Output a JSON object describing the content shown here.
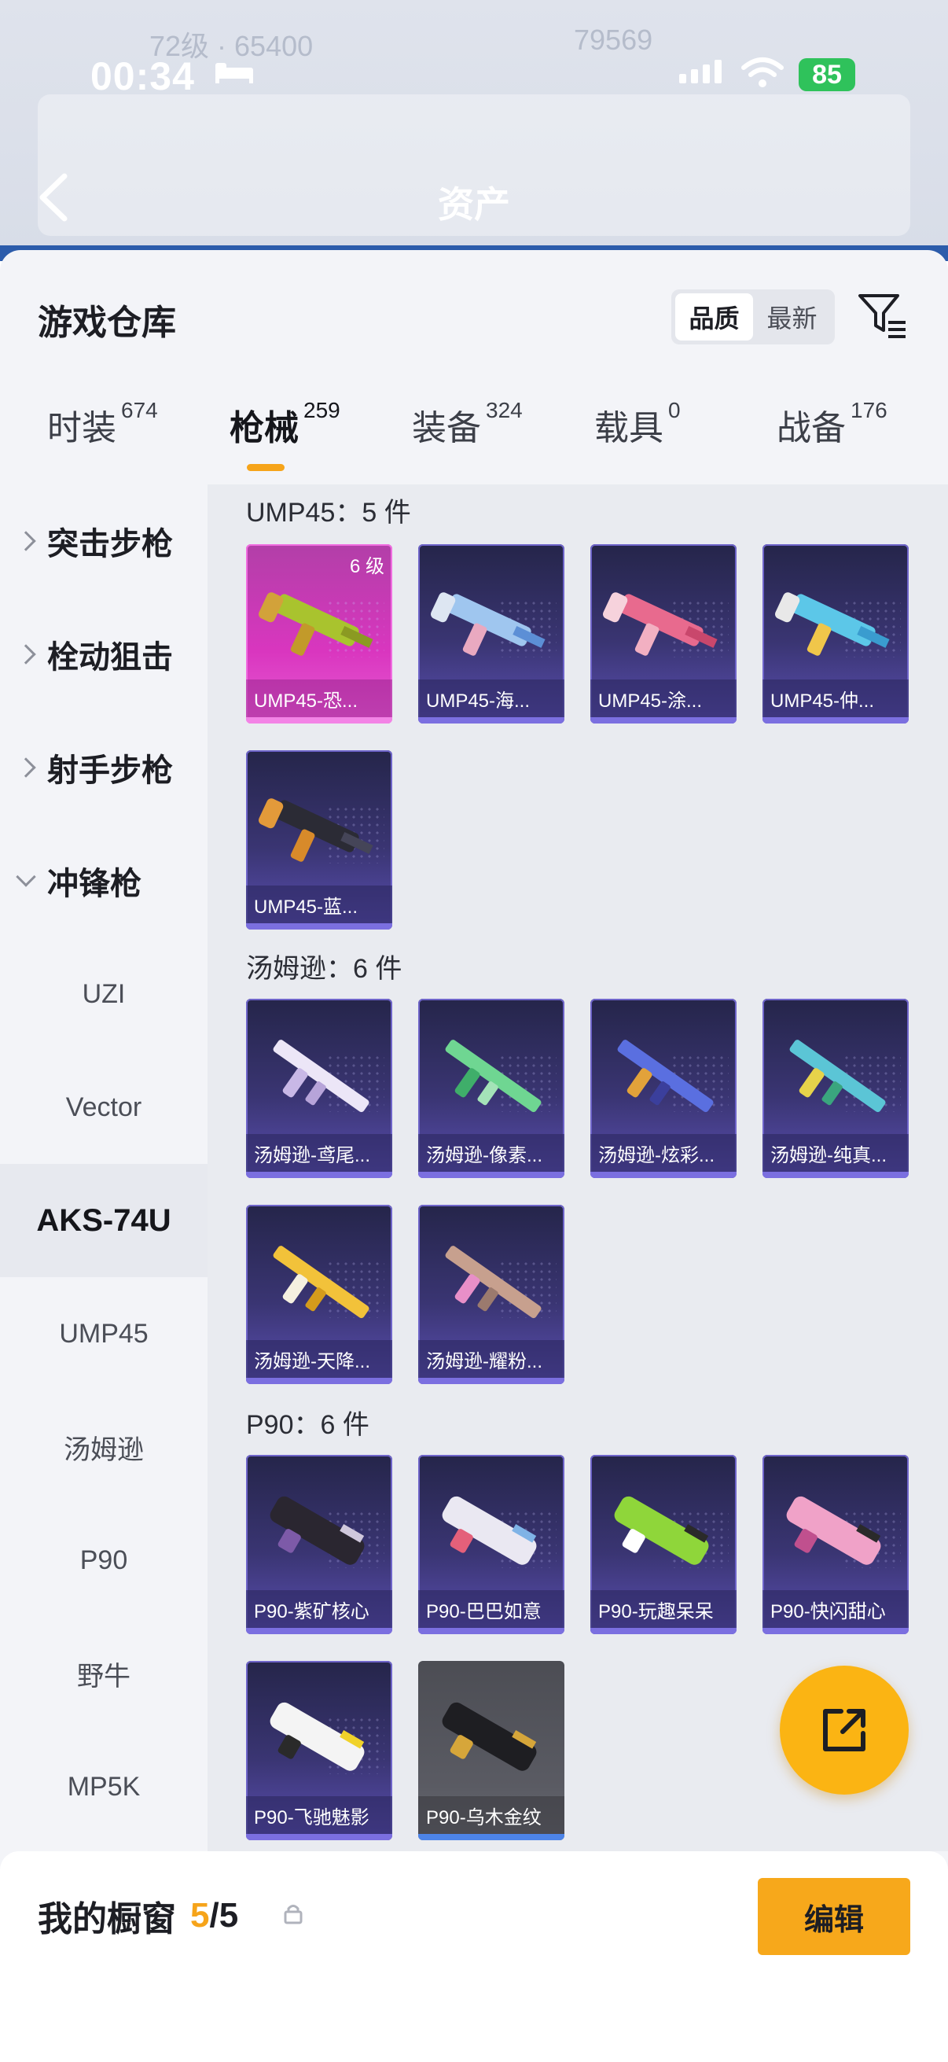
{
  "status_bar": {
    "time": "00:34",
    "battery": "85"
  },
  "header": {
    "title": "资产"
  },
  "warehouse": {
    "title": "游戏仓库",
    "sort_options": [
      "品质",
      "最新"
    ],
    "tabs": [
      {
        "label": "时装",
        "count": "674"
      },
      {
        "label": "枪械",
        "count": "259"
      },
      {
        "label": "装备",
        "count": "324"
      },
      {
        "label": "载具",
        "count": "0"
      },
      {
        "label": "战备",
        "count": "176"
      }
    ]
  },
  "sidebar": {
    "categories": [
      {
        "label": "突击步枪"
      },
      {
        "label": "栓动狙击"
      },
      {
        "label": "射手步枪"
      },
      {
        "label": "冲锋枪"
      }
    ],
    "subitems": [
      "UZI",
      "Vector",
      "AKS-74U",
      "UMP45",
      "汤姆逊",
      "P90",
      "野牛",
      "MP5K"
    ]
  },
  "sections": [
    {
      "title": "UMP45：5 件",
      "items": [
        {
          "name": "UMP45-恐...",
          "level": "6 级"
        },
        {
          "name": "UMP45-海..."
        },
        {
          "name": "UMP45-涂..."
        },
        {
          "name": "UMP45-仲..."
        },
        {
          "name": "UMP45-蓝..."
        }
      ]
    },
    {
      "title": "汤姆逊：6 件",
      "items": [
        {
          "name": "汤姆逊-鸢尾..."
        },
        {
          "name": "汤姆逊-像素..."
        },
        {
          "name": "汤姆逊-炫彩..."
        },
        {
          "name": "汤姆逊-纯真..."
        },
        {
          "name": "汤姆逊-天降..."
        },
        {
          "name": "汤姆逊-耀粉..."
        }
      ]
    },
    {
      "title": "P90：6 件",
      "items": [
        {
          "name": "P90-紫矿核心"
        },
        {
          "name": "P90-巴巴如意"
        },
        {
          "name": "P90-玩趣呆呆"
        },
        {
          "name": "P90-快闪甜心"
        },
        {
          "name": "P90-飞驰魅影"
        },
        {
          "name": "P90-乌木金纹"
        }
      ]
    }
  ],
  "bottom": {
    "window_label": "我的橱窗",
    "window_current": "5",
    "window_total": "/5",
    "edit_label": "编辑"
  },
  "colors": {
    "accent": "#f6a41a",
    "card_purple": "#3a3573",
    "card_pink": "#d936bf",
    "card_grey": "#5a5b63"
  },
  "icons": [
    "back-icon",
    "filter-icon",
    "share-icon",
    "lock-icon",
    "chevron-right-icon",
    "chevron-down-icon"
  ]
}
